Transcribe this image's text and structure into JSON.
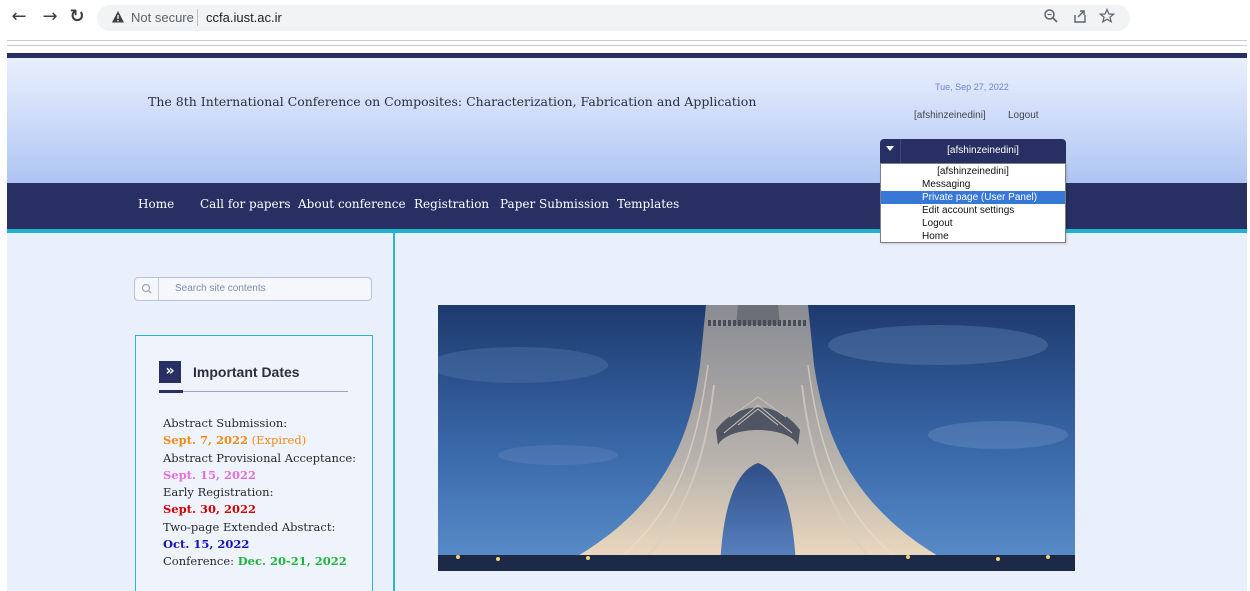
{
  "browser": {
    "back_icon": "arrow-left-icon",
    "forward_icon": "arrow-right-icon",
    "reload_icon": "reload-icon",
    "security_label": "Not secure",
    "url": "ccfa.iust.ac.ir",
    "zoom_icon": "zoom-icon",
    "share_icon": "share-icon",
    "bookmark_icon": "star-icon"
  },
  "header": {
    "title": "The 8th International Conference on Composites: Characterization, Fabrication and Application",
    "date": "Tue, Sep 27, 2022",
    "user_link": "[afshinzeinedini]",
    "logout_link": "Logout"
  },
  "user_dropdown": {
    "selected": "[afshinzeinedini]",
    "options": [
      "[afshinzeinedini]",
      "Messaging",
      "Private page (User Panel)",
      "Edit account settings",
      "Logout",
      "Home"
    ],
    "highlighted": "Private page (User Panel)"
  },
  "nav": {
    "items": [
      "Home",
      "Call for papers",
      "About conference",
      "Registration",
      "Paper Submission",
      "Templates"
    ]
  },
  "search": {
    "placeholder": "Search site contents"
  },
  "important_dates": {
    "title": "Important Dates",
    "abstract_submission_label": "Abstract Submission:",
    "abstract_submission_date": "Sept. 7, 2022",
    "abstract_submission_status": "(Expired)",
    "provisional_label": "Abstract Provisional Acceptance:",
    "provisional_date": "Sept. 15, 2022",
    "early_registration_label": "Early Registration:",
    "early_registration_date": "Sept. 30, 2022",
    "extended_abstract_label": "Two-page Extended Abstract:",
    "extended_abstract_date": "Oct. 15, 2022",
    "conference_label": "Conference:",
    "conference_date": "Dec. 20-21, 2022"
  },
  "colors": {
    "navy": "#272f63",
    "cyan": "#2bb6cd",
    "orange": "#f08a16",
    "pink": "#e66ed8",
    "red": "#d40000",
    "blue": "#1313b8",
    "green": "#1db53f"
  }
}
